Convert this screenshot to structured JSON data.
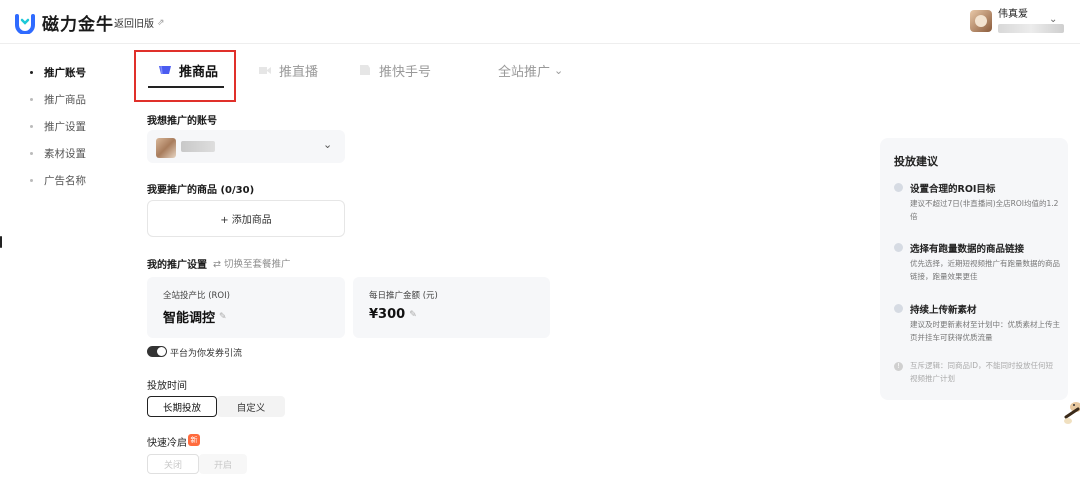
{
  "header": {
    "logo_text": "磁力金牛",
    "back_link": "返回旧版",
    "user_name": "伟真爱"
  },
  "sidebar": {
    "items": [
      {
        "label": "推广账号",
        "active": true
      },
      {
        "label": "推广商品",
        "active": false
      },
      {
        "label": "推广设置",
        "active": false
      },
      {
        "label": "素材设置",
        "active": false
      },
      {
        "label": "广告名称",
        "active": false
      }
    ]
  },
  "tabs": [
    {
      "label": "推商品",
      "icon": "shopping-cart-icon",
      "active": true
    },
    {
      "label": "推直播",
      "icon": "live-video-icon",
      "active": false
    },
    {
      "label": "推快手号",
      "icon": "profile-icon",
      "active": false
    },
    {
      "label": "全站推广",
      "icon": "chevron-down-icon",
      "active": false
    }
  ],
  "form": {
    "account_label": "我想推广的账号",
    "products_label": "我要推广的商品 (0/30)",
    "add_product": "+ 添加商品",
    "settings_label": "我的推广设置",
    "switch_link": "⇄ 切换至套餐推广",
    "roi_card_title": "全站投产比 (ROI)",
    "roi_card_value": "智能调控",
    "budget_card_title": "每日推广金额 (元)",
    "budget_card_value": "¥300",
    "coupon_toggle_label": "平台为你发券引流",
    "schedule_label": "投放时间",
    "schedule_options": [
      "长期投放",
      "自定义"
    ],
    "quick_start_label": "快速冷启",
    "quick_start_badge": "新",
    "quick_start_options": [
      "关闭",
      "开启"
    ]
  },
  "advice": {
    "title": "投放建议",
    "items": [
      {
        "title": "设置合理的ROI目标",
        "desc": "建议不超过7日(非直播间)全店ROI均值的1.2倍"
      },
      {
        "title": "选择有跑量数据的商品链接",
        "desc": "优先选择，近期短视频推广有跑量数据的商品链接，跑量效果更佳"
      },
      {
        "title": "持续上传新素材",
        "desc": "建议及时更新素材至计划中：优质素材上传主页并挂车可获得优质流量"
      }
    ],
    "note": "互斥逻辑：同商品ID，不能同时投放任何短视频推广计划"
  },
  "colors": {
    "highlight": "#e0302a",
    "brand_blue": "#3b6cf6",
    "badge_orange": "#ff6b3d"
  }
}
